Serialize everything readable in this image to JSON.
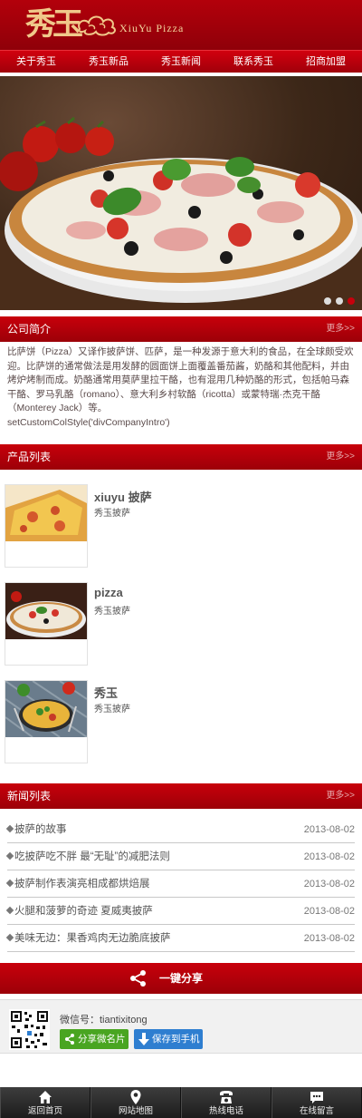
{
  "header": {
    "logo_glyph": "秀玉",
    "logo_text": "XiuYu  Pizza"
  },
  "nav": {
    "items": [
      "关于秀玉",
      "秀玉新品",
      "秀玉新闻",
      "联系秀玉",
      "招商加盟"
    ]
  },
  "banner": {
    "slide_count": 3,
    "active_slide": 3
  },
  "company_section": {
    "title": "公司简介",
    "more": "更多>>",
    "intro": "比萨饼（Pizza）又译作披萨饼、匹萨，是一种发源于意大利的食品，在全球颇受欢迎。比萨饼的通常做法是用发酵的圆面饼上面覆盖番茄酱，奶酪和其他配料，并由烤炉烤制而成。奶酪通常用莫萨里拉干酪，也有混用几种奶酪的形式，包括帕马森干酪、罗马乳酪（romano）、意大利乡村软酪（ricotta）或蒙特瑞·杰克干酪（Monterey Jack）等。",
    "script_text": "setCustomColStyle('divCompanyIntro')"
  },
  "product_section": {
    "title": "产品列表",
    "more": "更多>>",
    "items": [
      {
        "name": "xiuyu 披萨",
        "sub": "秀玉披萨"
      },
      {
        "name": "pizza",
        "sub": "秀玉披萨"
      },
      {
        "name": "秀玉",
        "sub": "秀玉披萨"
      }
    ]
  },
  "news_section": {
    "title": "新闻列表",
    "more": "更多>>",
    "items": [
      {
        "title": "披萨的故事",
        "date": "2013-08-02"
      },
      {
        "title": "吃披萨吃不胖   最“无耻”的减肥法则",
        "date": "2013-08-02"
      },
      {
        "title": "披萨制作表演亮相成都烘焙展",
        "date": "2013-08-02"
      },
      {
        "title": "火腿和菠萝的奇迹 夏威夷披萨",
        "date": "2013-08-02"
      },
      {
        "title": "美味无边：果香鸡肉无边脆底披萨",
        "date": "2013-08-02"
      }
    ]
  },
  "share": {
    "label": "一键分享"
  },
  "wechat": {
    "id_text": "微信号：tiantixitong",
    "share_button": "分享微名片",
    "save_button": "保存到手机"
  },
  "tabbar": {
    "items": [
      {
        "label": "返回首页",
        "icon": "home-icon"
      },
      {
        "label": "网站地图",
        "icon": "map-pin-icon"
      },
      {
        "label": "热线电话",
        "icon": "phone-icon"
      },
      {
        "label": "在线留言",
        "icon": "message-icon"
      }
    ]
  },
  "colors": {
    "brand_red": "#b3000b",
    "nav_red": "#d1000e",
    "share_green": "#49a521",
    "save_blue": "#2e7ed0",
    "tabbar_dark": "#2b2b2b"
  }
}
